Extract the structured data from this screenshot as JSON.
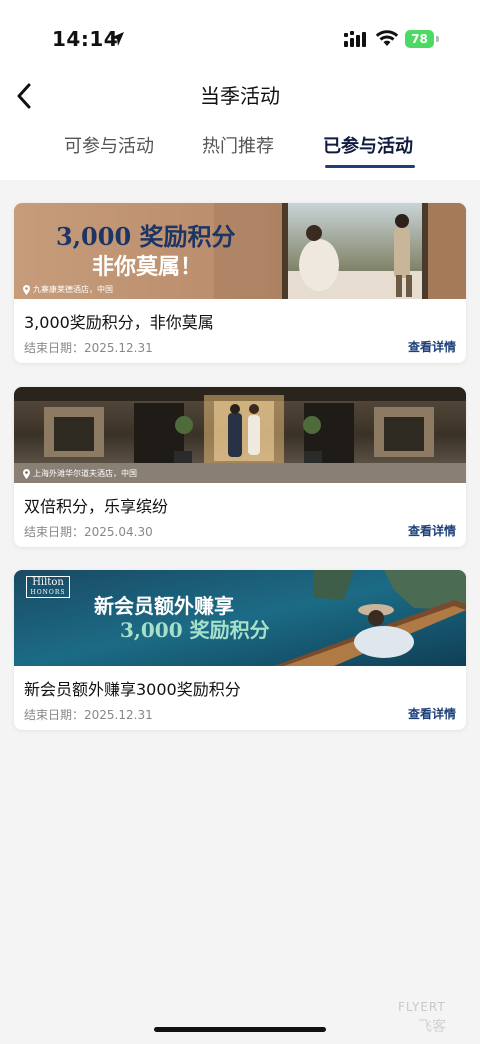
{
  "status": {
    "time": "14:14",
    "battery": "78"
  },
  "nav": {
    "title": "当季活动"
  },
  "tabs": [
    {
      "label": "可参与活动",
      "active": false
    },
    {
      "label": "热门推荐",
      "active": false
    },
    {
      "label": "已参与活动",
      "active": true
    }
  ],
  "cards": [
    {
      "banner_line1": "3,000 奖励积分",
      "banner_line2": "非你莫属！",
      "banner_location": "九寨康莱德酒店，中国",
      "title": "3,000奖励积分，非你莫属",
      "date": "结束日期：2025.12.31",
      "link": "查看详情"
    },
    {
      "banner_location": "上海外滩华尔道夫酒店，中国",
      "title": "双倍积分，乐享缤纷",
      "date": "结束日期：2025.04.30",
      "link": "查看详情"
    },
    {
      "banner_logo": "Hilton",
      "banner_logo_sub": "HONORS",
      "banner_line1": "新会员额外赚享",
      "banner_line2": "3,000 奖励积分",
      "title": "新会员额外赚享3000奖励积分",
      "date": "结束日期：2025.12.31",
      "link": "查看详情"
    }
  ],
  "watermark": {
    "line1": "FLYERT",
    "line2": "飞客"
  },
  "colors": {
    "accent": "#1d3f7a",
    "battery": "#4cd964"
  }
}
